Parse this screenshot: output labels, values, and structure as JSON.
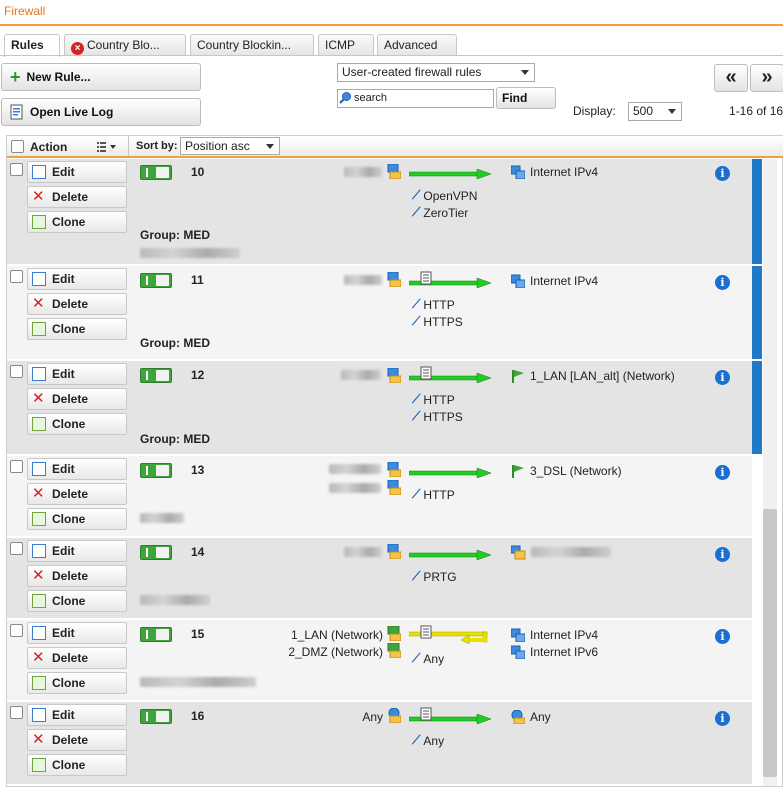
{
  "app": {
    "title": "Firewall"
  },
  "tabs": [
    {
      "label": "Rules",
      "active": true
    },
    {
      "label": "Country Blo...",
      "icon": "error-x-icon"
    },
    {
      "label": "Country Blockin..."
    },
    {
      "label": "ICMP"
    },
    {
      "label": "Advanced"
    }
  ],
  "toolbar": {
    "new_rule": "New Rule...",
    "open_live_log": "Open Live Log",
    "filter_select": "User-created firewall rules",
    "search_placeholder": "search",
    "find": "Find",
    "display_label": "Display:",
    "display_value": "500",
    "prev": "«",
    "next": "»",
    "range": "1-16 of 16"
  },
  "grid": {
    "action_header": "Action",
    "sort_label": "Sort by:",
    "sort_value": "Position asc"
  },
  "labels": {
    "edit": "Edit",
    "delete": "Delete",
    "clone": "Clone"
  },
  "rules": [
    {
      "position": "10",
      "group": "Group: MED",
      "services": [
        "OpenVPN",
        "ZeroTier"
      ],
      "destinations": [
        "Internet IPv4"
      ]
    },
    {
      "position": "11",
      "group": "Group: MED",
      "services": [
        "HTTP",
        "HTTPS"
      ],
      "destinations": [
        "Internet IPv4"
      ]
    },
    {
      "position": "12",
      "group": "Group: MED",
      "services": [
        "HTTP",
        "HTTPS"
      ],
      "destinations": [
        "1_LAN [LAN_alt] (Network)"
      ]
    },
    {
      "position": "13",
      "group": "",
      "services": [
        "HTTP"
      ],
      "destinations": [
        "3_DSL (Network)"
      ]
    },
    {
      "position": "14",
      "group": "",
      "services": [
        "PRTG"
      ],
      "destinations": []
    },
    {
      "position": "15",
      "group": "",
      "sources": [
        "1_LAN (Network)",
        "2_DMZ (Network)"
      ],
      "services": [
        "Any"
      ],
      "destinations": [
        "Internet IPv4",
        "Internet IPv6"
      ]
    },
    {
      "position": "16",
      "group": "",
      "sources": [
        "Any"
      ],
      "services": [
        "Any"
      ],
      "destinations": [
        "Any"
      ]
    }
  ],
  "colors": {
    "accent": "#e8731a",
    "enabled": "#3ea43b",
    "arrow_green": "#22cc22",
    "arrow_yellow": "#e8e000",
    "info_blue": "#1b6fd0"
  }
}
